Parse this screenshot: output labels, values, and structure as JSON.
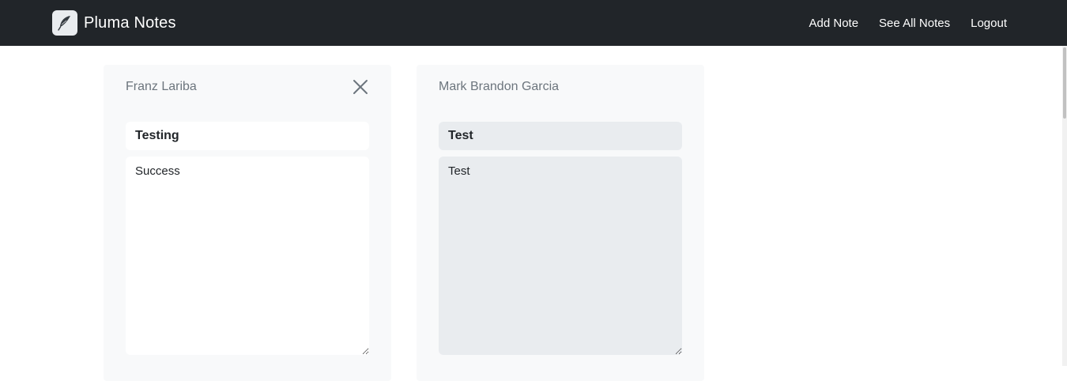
{
  "navbar": {
    "brand": "Pluma Notes",
    "links": [
      "Add Note",
      "See All Notes",
      "Logout"
    ]
  },
  "notes": [
    {
      "author": "Franz Lariba",
      "title": "Testing",
      "body": "Success",
      "editable": true
    },
    {
      "author": "Mark Brandon Garcia",
      "title": "Test",
      "body": "Test",
      "editable": false
    }
  ],
  "icons": {
    "logo": "feather-icon",
    "close": "close-icon"
  },
  "colors": {
    "navbar": "#212529",
    "card": "#f8f9fa",
    "readonly_field": "#e9ecef"
  }
}
